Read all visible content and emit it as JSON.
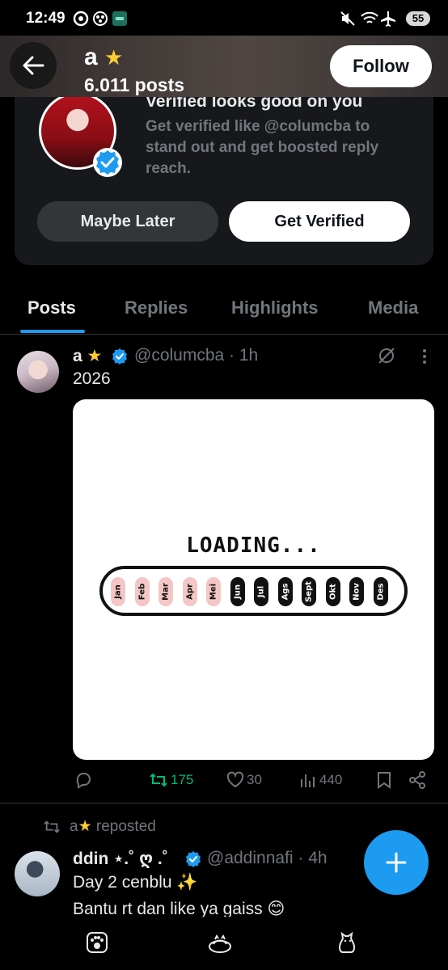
{
  "status_bar": {
    "time": "12:49",
    "battery": "55"
  },
  "header": {
    "name": "a",
    "posts_count": "6.011 posts",
    "follow_label": "Follow"
  },
  "verify_card": {
    "title": "Verified looks good on you",
    "description": "Get verified like @columcba to stand out and get boosted reply reach.",
    "maybe_later_label": "Maybe Later",
    "get_verified_label": "Get Verified"
  },
  "tabs": [
    {
      "label": "Posts"
    },
    {
      "label": "Replies"
    },
    {
      "label": "Highlights"
    },
    {
      "label": "Media"
    }
  ],
  "post": {
    "name": "a",
    "handle_time": "@columcba · 1h",
    "text": "2026",
    "media": {
      "title": "LOADING...",
      "months": [
        {
          "label": "Jan",
          "done": true
        },
        {
          "label": "Feb",
          "done": true
        },
        {
          "label": "Mar",
          "done": true
        },
        {
          "label": "Apr",
          "done": true
        },
        {
          "label": "Mei",
          "done": true
        },
        {
          "label": "Jun",
          "done": false
        },
        {
          "label": "Jul",
          "done": false
        },
        {
          "label": "Ags",
          "done": false
        },
        {
          "label": "Sept",
          "done": false
        },
        {
          "label": "Okt",
          "done": false
        },
        {
          "label": "Nov",
          "done": false
        },
        {
          "label": "Des",
          "done": false
        }
      ]
    },
    "reposts": "175",
    "likes": "30",
    "views": "440"
  },
  "repost": {
    "label": "reposted",
    "reposter": "a",
    "name": "ddin ⋆.˚ ღ .˚",
    "handle_time": "@addinnafi · 4h",
    "line1": "Day 2 cenblu ✨",
    "line2": "Bantu rt dan like ya gaiss 😊"
  },
  "colors": {
    "accent": "#1d9bf0",
    "repost_green": "#00ba7c",
    "muted": "#71767b"
  }
}
